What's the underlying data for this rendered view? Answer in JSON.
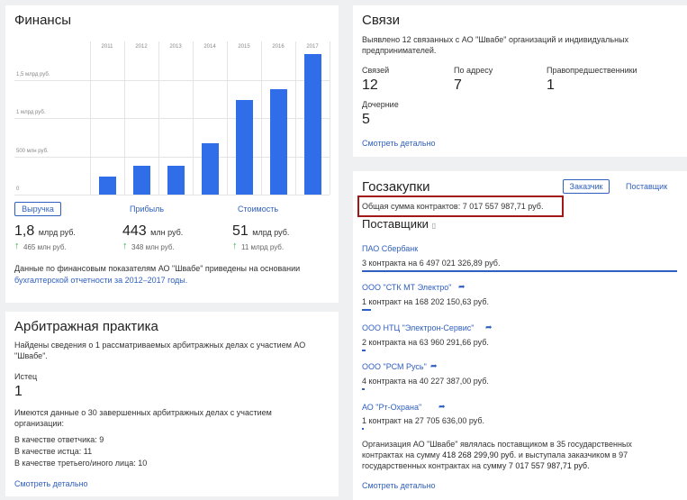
{
  "finances": {
    "title": "Финансы",
    "chart_data": {
      "type": "bar",
      "categories": [
        "2011",
        "2012",
        "2013",
        "2014",
        "2015",
        "2016",
        "2017"
      ],
      "values": [
        0.24,
        0.38,
        0.38,
        0.67,
        1.24,
        1.38,
        1.84
      ],
      "ylabel": "",
      "yticks": [
        "0",
        "500 млн руб.",
        "1 млрд руб.",
        "1,5 млрд руб."
      ],
      "ylim": [
        0,
        2.0
      ],
      "unit": "млрд руб."
    },
    "tabs": {
      "revenue": "Выручка",
      "profit": "Прибыль",
      "value": "Стоимость"
    },
    "metrics": [
      {
        "value": "1,8",
        "unit": "млрд руб.",
        "prev": "465 млн руб."
      },
      {
        "value": "443",
        "unit": "млн руб.",
        "prev": "348 млн руб."
      },
      {
        "value": "51",
        "unit": "млрд руб.",
        "prev": "11 млрд руб."
      }
    ],
    "note": "Данные по финансовым показателям АО \"Швабе\" приведены на основании",
    "note_link": "бухгалтерской отчетности за 2012–2017 годы."
  },
  "links": {
    "title": "Связи",
    "desc": "Выявлено 12 связанных с АО \"Швабе\" организаций и индивидуальных предпринимателей.",
    "stats": [
      {
        "label": "Связей",
        "value": "12"
      },
      {
        "label": "По адресу",
        "value": "7"
      },
      {
        "label": "Правопредшественники",
        "value": "1"
      },
      {
        "label": "Дочерние",
        "value": "5"
      }
    ],
    "more": "Смотреть детально"
  },
  "arbitration": {
    "title": "Арбитражная практика",
    "desc": "Найдены сведения о 1 рассматриваемых арбитражных делах с участием АО \"Швабе\".",
    "plaintiff_label": "Истец",
    "plaintiff_value": "1",
    "completed": "Имеются данные о 30 завершенных арбитражных делах с участием организации:",
    "roles": [
      "В качестве ответчика: 9",
      "В качестве истца: 11",
      "В качестве третьего/иного лица: 10"
    ],
    "more": "Смотреть детально"
  },
  "procurement": {
    "title": "Госзакупки",
    "tab_customer": "Заказчик",
    "tab_supplier": "Поставщик",
    "total": "Общая сумма контрактов: 7 017 557 987,71 руб.",
    "suppliers_title": "Поставщики",
    "suppliers": [
      {
        "name": "ПАО Сбербанк",
        "text": "3 контракта на",
        "amount": "6 497 021 326,89 руб.",
        "share": 1.0
      },
      {
        "name": "ООО \"СТК МТ Электро\"",
        "text": "1 контракт на",
        "amount": "168 202 150,63 руб.",
        "share": 0.03
      },
      {
        "name": "ООО НТЦ \"Электрон-Сервис\"",
        "text": "2 контракта на",
        "amount": "63 960 291,66 руб.",
        "share": 0.01
      },
      {
        "name": "ООО \"РСМ Русь\"",
        "text": "4 контракта на",
        "amount": "40 227 387,00 руб.",
        "share": 0.01
      },
      {
        "name": "АО \"Рт-Охрана\"",
        "text": "1 контракт на",
        "amount": "27 705 636,00 руб.",
        "share": 0.005
      }
    ],
    "summary_1": "Организация АО \"Швабе\" являлась поставщиком в 35 государственных",
    "summary_2a": "контрактах на сумму ",
    "summary_2b": "418 268 299,90 руб.",
    "summary_2c": " и выступала заказчиком в 97",
    "summary_3a": "государственных контрактах на сумму ",
    "summary_3b": "7 017 557 987,71 руб.",
    "more": "Смотреть детально"
  },
  "colors": {
    "accent": "#2f5fbf",
    "bar": "#2f6ee8",
    "highlight": "#a01818",
    "up": "#3cb44b"
  }
}
